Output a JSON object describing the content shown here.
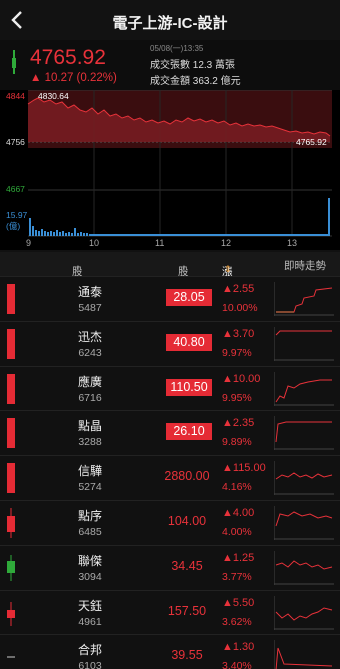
{
  "header": {
    "title": "電子上游-IC-設計"
  },
  "summary": {
    "price": "4765.92",
    "change": "▲ 10.27 (0.22%)",
    "datetime": "05/08(一)13:35",
    "volume_label": "成交張數",
    "volume_value": "12.3 萬張",
    "amount_label": "成交金額",
    "amount_value": "363.2 億元"
  },
  "chart": {
    "y_top": "4844",
    "y_mid": "4756",
    "y_low": "4667",
    "vol_top": "15.97",
    "vol_unit": "(億)",
    "high_label": "4830.64",
    "last_label": "4765.92",
    "x_labels": [
      "9",
      "10",
      "11",
      "12",
      "13"
    ]
  },
  "table_header": {
    "stock": "股票",
    "price": "股價",
    "change": "漲跌幅",
    "trend": "即時走勢"
  },
  "rows": [
    {
      "name": "通泰",
      "code": "5487",
      "price": "28.05",
      "chg": "▲2.55",
      "pct": "10.00%",
      "limit": true,
      "candle": "red"
    },
    {
      "name": "迅杰",
      "code": "6243",
      "price": "40.80",
      "chg": "▲3.70",
      "pct": "9.97%",
      "limit": true,
      "candle": "red"
    },
    {
      "name": "應廣",
      "code": "6716",
      "price": "110.50",
      "chg": "▲10.00",
      "pct": "9.95%",
      "limit": true,
      "candle": "red"
    },
    {
      "name": "點晶",
      "code": "3288",
      "price": "26.10",
      "chg": "▲2.35",
      "pct": "9.89%",
      "limit": true,
      "candle": "red"
    },
    {
      "name": "信驊",
      "code": "5274",
      "price": "2880.00",
      "chg": "▲115.00",
      "pct": "4.16%",
      "limit": false,
      "candle": "red"
    },
    {
      "name": "點序",
      "code": "6485",
      "price": "104.00",
      "chg": "▲4.00",
      "pct": "4.00%",
      "limit": false,
      "candle": "red-wick"
    },
    {
      "name": "聯傑",
      "code": "3094",
      "price": "34.45",
      "chg": "▲1.25",
      "pct": "3.77%",
      "limit": false,
      "candle": "green"
    },
    {
      "name": "天鈺",
      "code": "4961",
      "price": "157.50",
      "chg": "▲5.50",
      "pct": "3.62%",
      "limit": false,
      "candle": "red-cross"
    },
    {
      "name": "合邦",
      "code": "6103",
      "price": "39.55",
      "chg": "▲1.30",
      "pct": "3.40%",
      "limit": false,
      "candle": "flat"
    }
  ],
  "colors": {
    "up": "#e8323a",
    "down": "#2faa3a",
    "volume": "#3a8fd6",
    "accent": "#f0a03c"
  }
}
